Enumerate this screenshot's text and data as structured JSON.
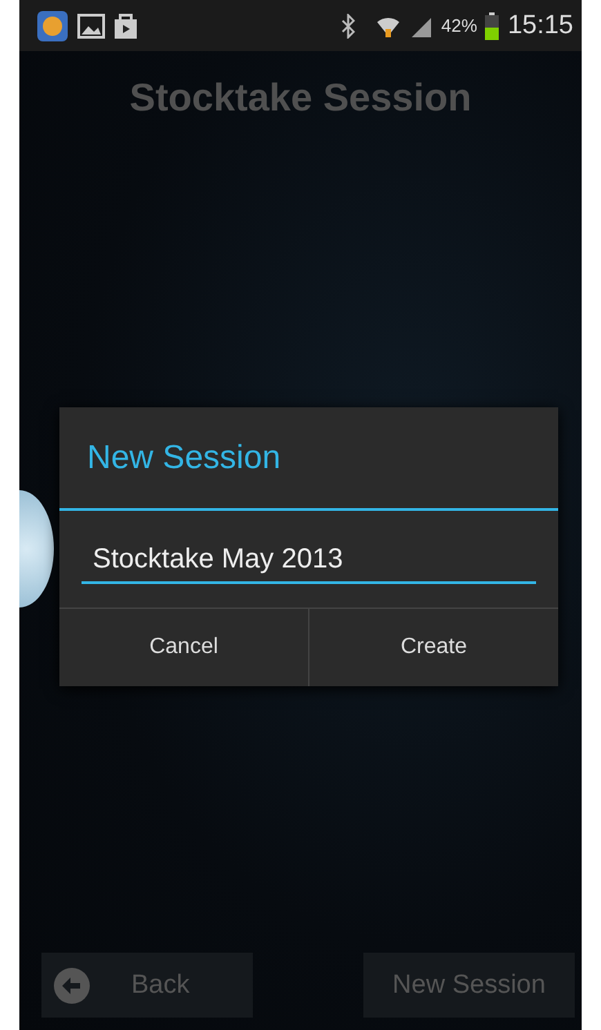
{
  "status_bar": {
    "battery_text": "42%",
    "time": "15:15"
  },
  "title": "Stocktake Session",
  "dialog": {
    "title": "New Session",
    "field_value": "Stocktake May 2013",
    "buttons": [
      "Cancel",
      "Create"
    ]
  },
  "bottom_buttons": [
    {
      "kind": "back",
      "label": "Back"
    },
    {
      "kind": "plain",
      "label": "New Session"
    }
  ]
}
